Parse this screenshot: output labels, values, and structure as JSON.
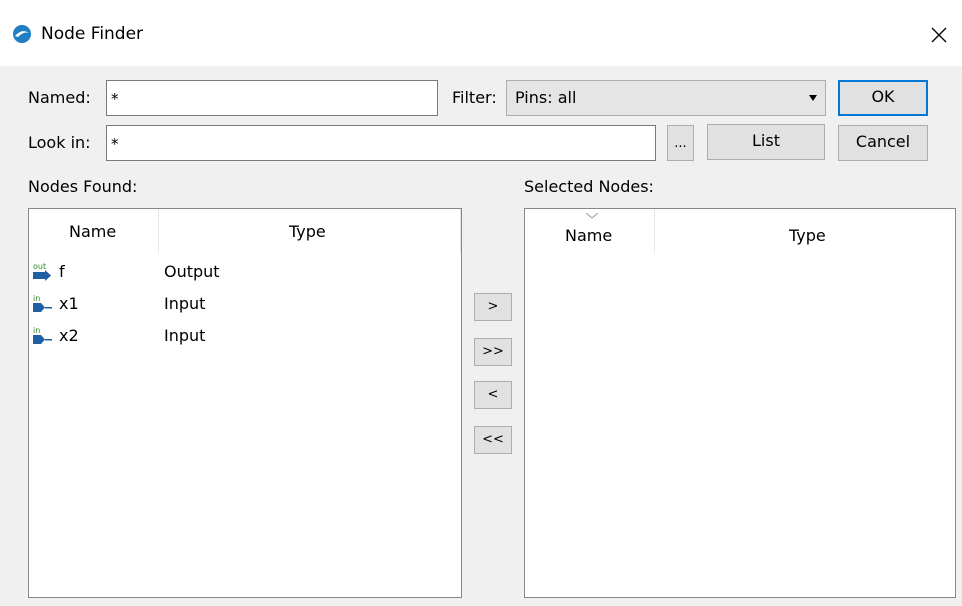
{
  "window": {
    "title": "Node Finder"
  },
  "form": {
    "named_label": "Named:",
    "named_value": "*",
    "filter_label": "Filter:",
    "filter_value": "Pins: all",
    "look_in_label": "Look in:",
    "look_in_value": "*",
    "browse_label": "...",
    "list_label": "List",
    "ok_label": "OK",
    "cancel_label": "Cancel"
  },
  "nodes_found": {
    "label": "Nodes Found:",
    "columns": {
      "name": "Name",
      "type": "Type"
    },
    "rows": [
      {
        "icon_tag": "out",
        "name": "f",
        "type": "Output"
      },
      {
        "icon_tag": "in",
        "name": "x1",
        "type": "Input"
      },
      {
        "icon_tag": "in",
        "name": "x2",
        "type": "Input"
      }
    ]
  },
  "transfer": {
    "add_one": ">",
    "add_all": ">>",
    "remove_one": "<",
    "remove_all": "<<"
  },
  "selected_nodes": {
    "label": "Selected Nodes:",
    "columns": {
      "name": "Name",
      "type": "Type"
    },
    "rows": []
  },
  "colors": {
    "accent": "#0078d7",
    "pin_blue": "#1f5fa6",
    "pin_tag_out": "#2a8a2a",
    "pin_tag_in": "#2a8a2a"
  }
}
